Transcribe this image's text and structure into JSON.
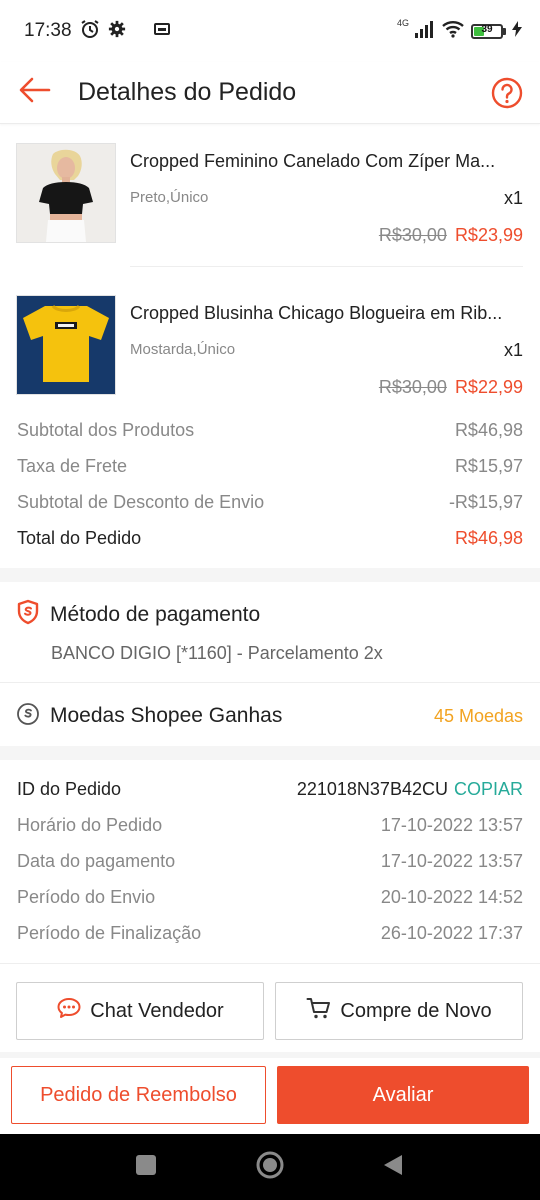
{
  "status_bar": {
    "time": "17:38",
    "network": "4G",
    "battery": "39",
    "battery_level": 0.39
  },
  "header": {
    "title": "Detalhes do Pedido"
  },
  "products": [
    {
      "name": "Cropped Feminino Canelado Com Zíper Ma...",
      "variant": "Preto,Único",
      "qty": "x1",
      "old_price": "R$30,00",
      "new_price": "R$23,99"
    },
    {
      "name": "Cropped Blusinha Chicago Blogueira em Rib...",
      "variant": "Mostarda,Único",
      "qty": "x1",
      "old_price": "R$30,00",
      "new_price": "R$22,99"
    }
  ],
  "summary": [
    {
      "label": "Subtotal dos Produtos",
      "value": "R$46,98"
    },
    {
      "label": "Taxa de Frete",
      "value": "R$15,97"
    },
    {
      "label": "Subtotal de Desconto de Envio",
      "value": "-R$15,97"
    },
    {
      "label": "Total do Pedido",
      "value": "R$46,98"
    }
  ],
  "payment": {
    "title": "Método de pagamento",
    "detail": "BANCO DIGIO [*1160] - Parcelamento 2x"
  },
  "coins": {
    "title": "Moedas Shopee Ganhas",
    "value": "45 Moedas"
  },
  "order_info": {
    "id_label": "ID do Pedido",
    "id_value": "221018N37B42CU",
    "copy_label": "COPIAR",
    "rows": [
      {
        "label": "Horário do Pedido",
        "value": "17-10-2022 13:57"
      },
      {
        "label": "Data do pagamento",
        "value": "17-10-2022 13:57"
      },
      {
        "label": "Período do Envio",
        "value": "20-10-2022 14:52"
      },
      {
        "label": "Período de Finalização",
        "value": "26-10-2022 17:37"
      }
    ]
  },
  "actions": {
    "chat_seller": "Chat Vendedor",
    "buy_again": "Compre de Novo",
    "refund": "Pedido de Reembolso",
    "rate": "Avaliar"
  },
  "colors": {
    "accent": "#ee4d2d",
    "coins": "#f2a321",
    "copy": "#26aa99"
  },
  "icons": [
    "back-arrow-icon",
    "help-icon",
    "shield-icon",
    "coin-icon",
    "chat-icon",
    "cart-icon",
    "alarm-icon",
    "settings-icon",
    "sim-icon",
    "signal-icon",
    "wifi-icon",
    "battery-icon",
    "charging-icon",
    "nav-recents-icon",
    "nav-home-icon",
    "nav-back-icon"
  ]
}
